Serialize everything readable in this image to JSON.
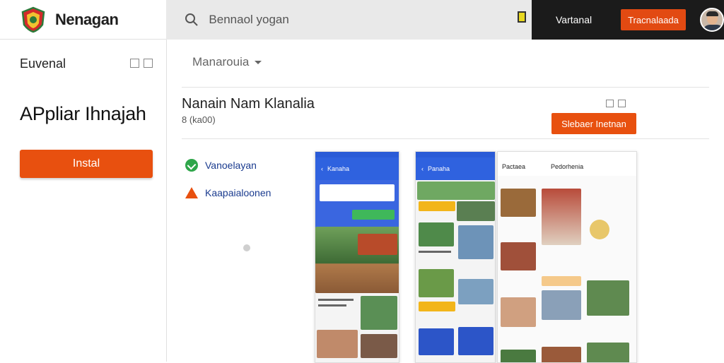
{
  "header": {
    "brand_name": "Nenagan",
    "search_placeholder": "Bennaol yogan",
    "dark_label": "Vartanal",
    "top_button": "Tracnalaada"
  },
  "sidebar": {
    "title": "Euvenal",
    "app_title": "APpliar Ihnajah",
    "install_label": "Instal"
  },
  "main": {
    "dropdown_label": "Manarouia",
    "item_title": "Nanain Nam Klanalia",
    "item_meta": "8 (ka00)",
    "action_button": "Slebaer Inetnan",
    "features": [
      {
        "label": "Vanoelayan",
        "icon": "check-circle-icon",
        "color": "#2fa64a"
      },
      {
        "label": "Kaapaialoonen",
        "icon": "warning-icon",
        "color": "#e8500f"
      }
    ]
  },
  "screenshots": {
    "phone1_title": "Kanaha",
    "phone2_title": "Panaha",
    "phone3_left_title": "Pactaea",
    "phone3_right_title": "Pedorhenia"
  },
  "colors": {
    "accent": "#e8500f",
    "dark_bar": "#1b1b1b",
    "app_blue": "#2f62df"
  }
}
